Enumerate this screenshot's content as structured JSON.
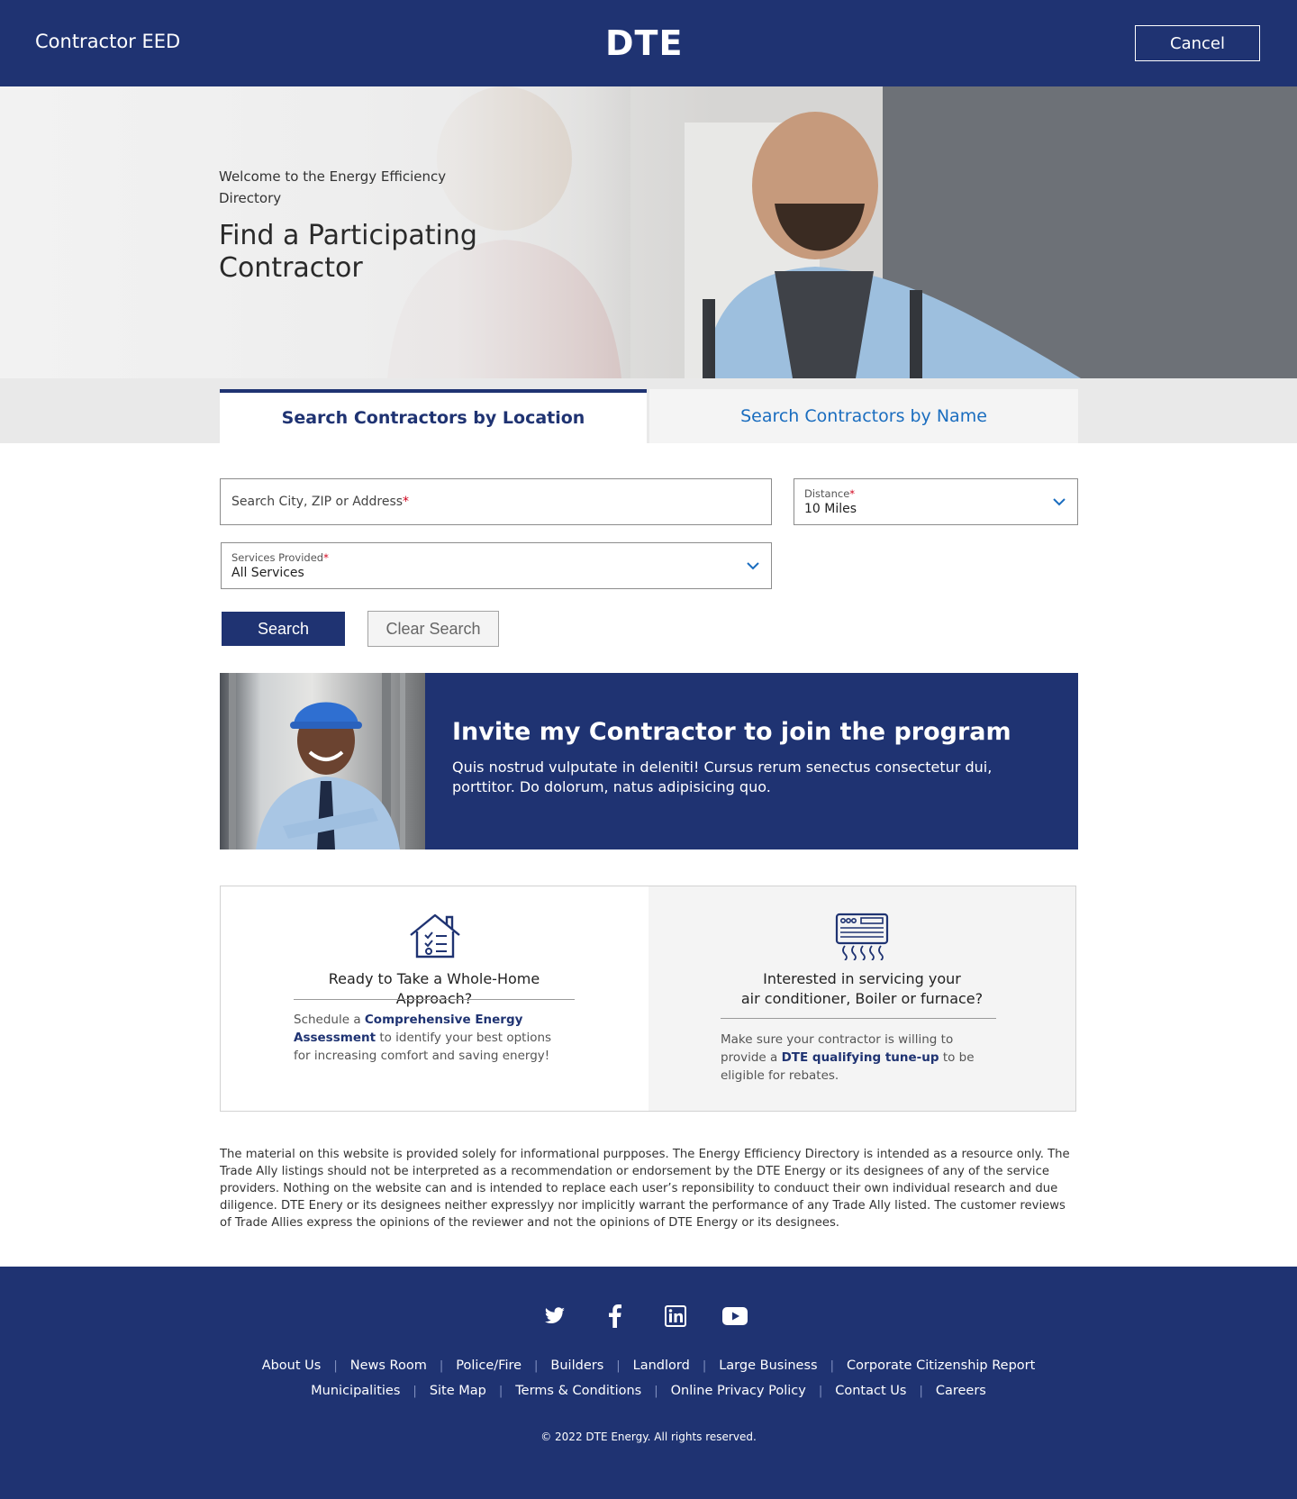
{
  "header": {
    "app_title": "Contractor EED",
    "logo_text": "DTE",
    "cancel_label": "Cancel"
  },
  "hero": {
    "kicker": "Welcome to the Energy Efficiency Directory",
    "title": "Find a Participating Contractor"
  },
  "tabs": [
    {
      "label": "Search Contractors by Location",
      "active": true
    },
    {
      "label": "Search Contractors by Name",
      "active": false
    }
  ],
  "form": {
    "search_placeholder": "Search City, ZIP or Address",
    "required_mark": "*",
    "distance": {
      "label": "Distance",
      "value": "10 Miles"
    },
    "services": {
      "label": "Services Provided",
      "value": "All Services"
    },
    "search_label": "Search",
    "clear_label": "Clear Search"
  },
  "invite": {
    "title": "Invite my Contractor to join the program",
    "body": "Quis nostrud vulputate in deleniti! Cursus rerum senectus consectetur dui, porttitor. Do dolorum, natus adipisicing quo."
  },
  "cards": [
    {
      "icon": "house-checklist-icon",
      "title": "Ready to Take a Whole-Home Approach?",
      "body_before": "Schedule a ",
      "link": "Comprehensive Energy Assessment",
      "body_after": " to identify your best options for increasing comfort and saving energy!"
    },
    {
      "icon": "hvac-unit-icon",
      "title_line1": "Interested in servicing your",
      "title_line2": "air conditioner, Boiler or furnace?",
      "body_before": "Make sure your contractor is willing to provide a ",
      "link": "DTE qualifying tune-up",
      "body_after": " to be eligible for rebates."
    }
  ],
  "disclaimer": "The material on this website is provided solely for informational purpposes. The Energy Efficiency Directory is intended as a resource only. The Trade Ally listings should not be interpreted as a recommendation or endorsement by the DTE Energy or its designees of any of the service providers. Nothing on the website can and is intended to replace each user’s reponsibility to conduuct their own individual research and due diligence. DTE Enery or its designees neither expresslyy nor implicitly warrant the performance of any Trade Ally listed. The customer reviews of Trade Allies express the opinions of the reviewer and not the opinions of DTE Energy or its designees.",
  "footer": {
    "social": [
      "twitter-icon",
      "facebook-icon",
      "linkedin-icon",
      "youtube-icon"
    ],
    "links_row1": [
      "About Us",
      "News Room",
      "Police/Fire",
      "Builders",
      "Landlord",
      "Large Business",
      "Corporate Citizenship Report"
    ],
    "links_row2": [
      "Municipalities",
      "Site Map",
      "Terms & Conditions",
      "Online Privacy Policy",
      "Contact Us",
      "Careers"
    ],
    "separator": "|",
    "copyright": "© 2022 DTE Energy. All rights reserved."
  },
  "colors": {
    "brand_navy": "#1f3372",
    "link_blue": "#1a6dbf",
    "required_red": "#d0021b"
  }
}
